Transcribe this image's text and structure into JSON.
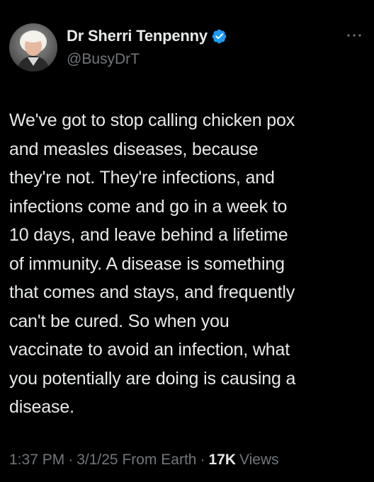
{
  "author": {
    "display_name": "Dr Sherri Tenpenny",
    "handle": "@BusyDrT",
    "verified_icon": "verified-badge-icon",
    "verified_color": "#1d9bf0"
  },
  "tweet": {
    "text": "We've got to stop calling chicken pox\nand measles diseases, because\nthey're not. They're infections, and\ninfections come and go in a week to\n10 days, and leave behind a lifetime\nof immunity.  A disease is something\nthat comes and stays, and frequently\ncan't be cured.  So when you\nvaccinate to avoid an infection, what\nyou potentially are doing is causing a\ndisease."
  },
  "meta": {
    "time": "1:37 PM",
    "separator_1": "·",
    "date": "3/1/25 From Earth",
    "separator_2": "·",
    "views_count": "17K",
    "views_label": "Views"
  },
  "icons": {
    "more": "more-options-icon",
    "avatar": "avatar"
  },
  "colors": {
    "background": "#000000",
    "primary_text": "#e7e9ea",
    "secondary_text": "#71767b"
  }
}
